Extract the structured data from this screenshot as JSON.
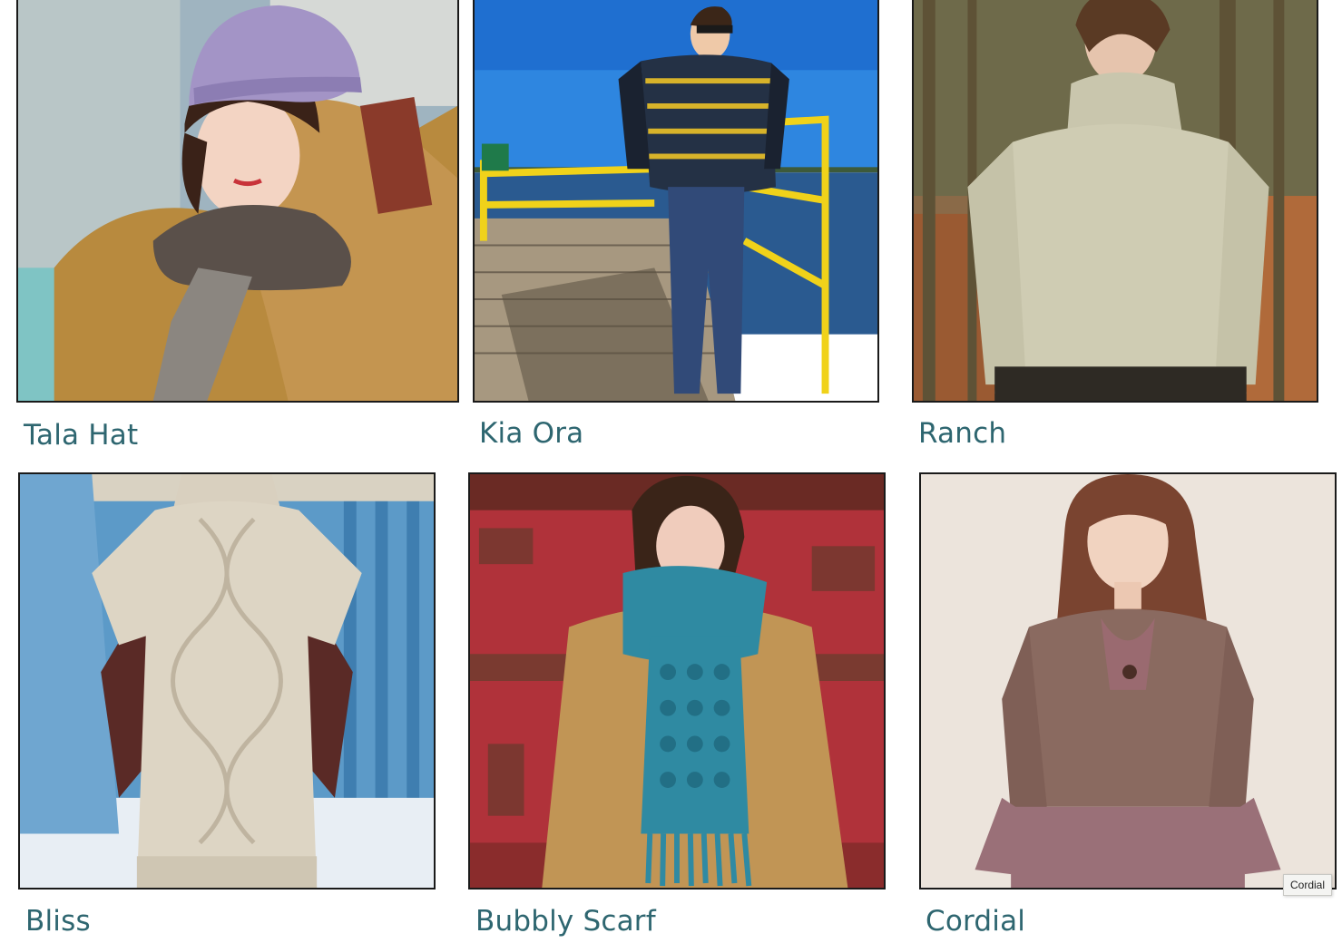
{
  "patterns": [
    {
      "title": "Tala Hat"
    },
    {
      "title": "Kia Ora"
    },
    {
      "title": "Ranch"
    },
    {
      "title": "Bliss"
    },
    {
      "title": "Bubbly Scarf"
    },
    {
      "title": "Cordial"
    }
  ],
  "tooltip": {
    "text": "Cordial"
  },
  "colors": {
    "title_link": "#2e6670",
    "photo_border": "#1a1a1a",
    "background": "#ffffff"
  }
}
